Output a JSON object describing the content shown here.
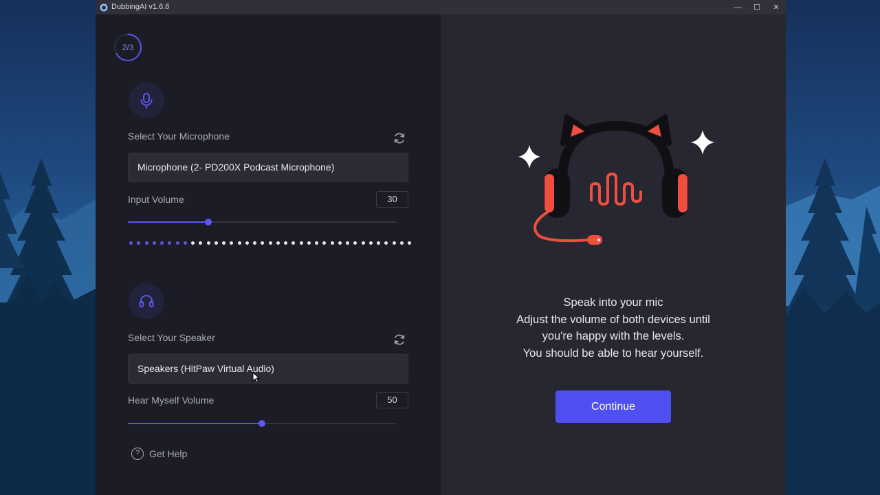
{
  "window": {
    "title": "DubbingAI v1.6.6",
    "controls": {
      "minimize": "—",
      "maximize": "☐",
      "close": "✕"
    }
  },
  "step": {
    "label": "2/3",
    "progress": 0.667
  },
  "microphone": {
    "section_label": "Select Your Microphone",
    "selected_device": "Microphone (2- PD200X Podcast Microphone)",
    "volume_label": "Input Volume",
    "volume_value": "30",
    "volume_level": 30,
    "volume_max": 100,
    "meter": {
      "total_dots": 37,
      "active_dots": 8
    }
  },
  "speaker": {
    "section_label": "Select Your Speaker",
    "selected_device": "Speakers (HitPaw Virtual Audio)",
    "volume_label": "Hear Myself Volume",
    "volume_value": "50",
    "volume_level": 50,
    "volume_max": 100
  },
  "help": {
    "label": "Get Help"
  },
  "right_panel": {
    "message_lines": [
      "Speak into your mic",
      "Adjust the volume of both devices until",
      "you're happy with the levels.",
      "You should be able to hear yourself."
    ],
    "continue_label": "Continue"
  },
  "colors": {
    "accent": "#5a56ef",
    "button": "#4f4ff2",
    "mascot_red": "#f04e3e",
    "left_bg": "#1b1c25",
    "right_bg": "#262731"
  }
}
